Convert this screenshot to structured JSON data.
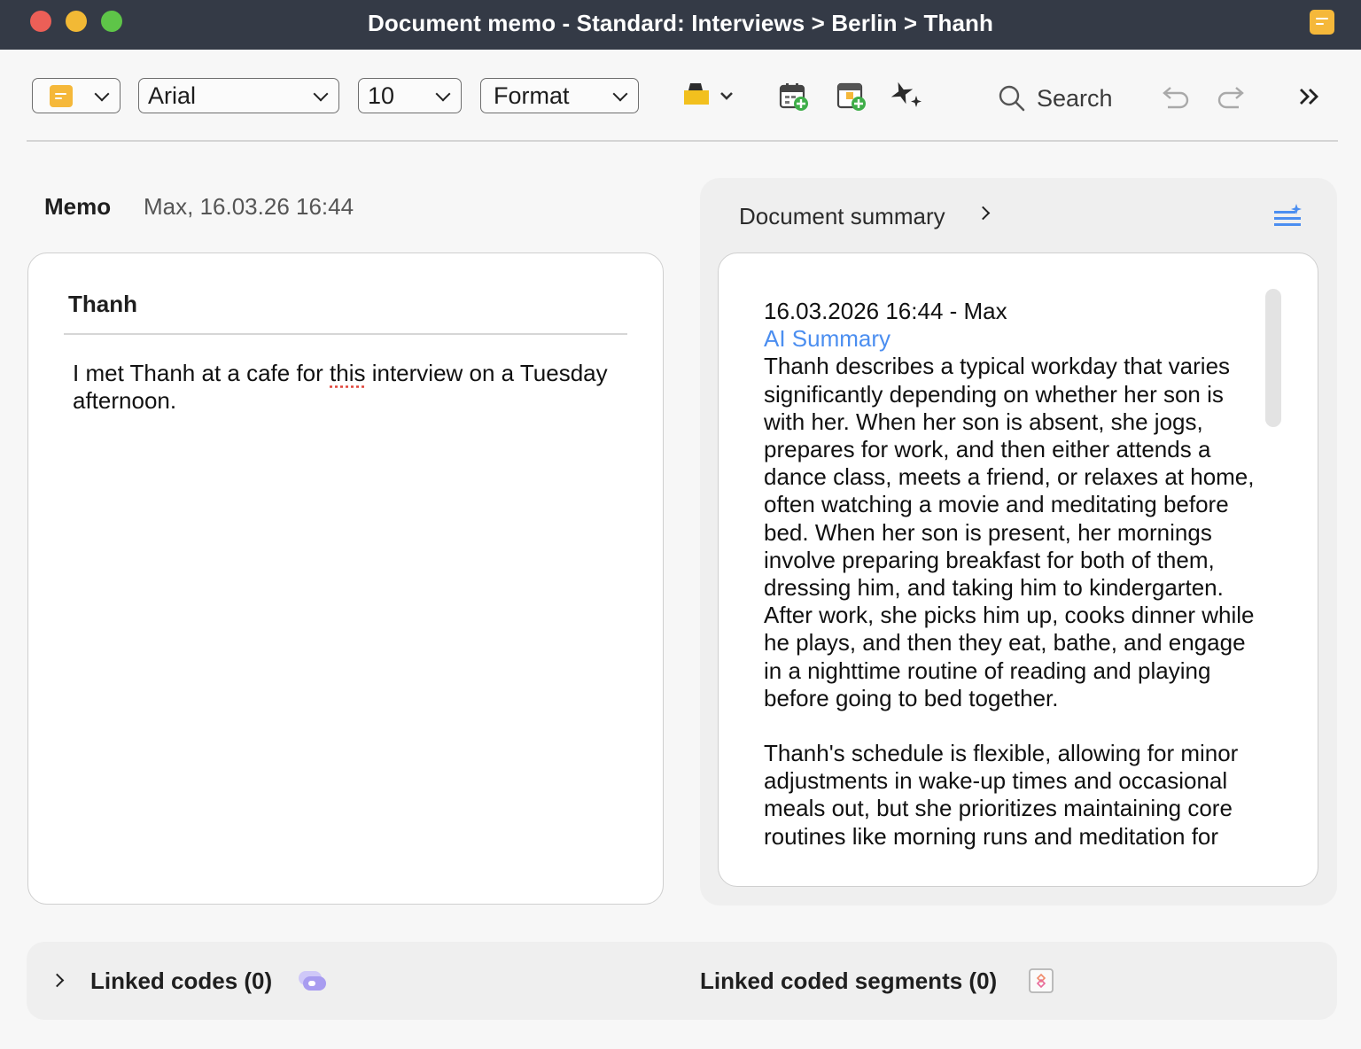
{
  "window": {
    "title": "Document memo - Standard: Interviews > Berlin > Thanh",
    "memo_icon": "memo-note-icon"
  },
  "toolbar": {
    "memo_type_icon": "memo-note-icon",
    "font_family": "Arial",
    "font_size": "10",
    "format": "Format",
    "highlight_icon": "highlighter-icon",
    "insert_date_icon": "calendar-add-icon",
    "insert_table_icon": "table-add-icon",
    "ai_icon": "ai-sparkle-icon",
    "search_label": "Search",
    "undo_icon": "undo-icon",
    "redo_icon": "redo-icon",
    "more_icon": "double-chevron-right-icon"
  },
  "memo": {
    "label": "Memo",
    "meta": "Max, 16.03.26 16:44",
    "title": "Thanh",
    "body_before": "I met Thanh at a cafe for ",
    "body_misspelled": "this",
    "body_after": " interview on a Tuesday afternoon."
  },
  "summary": {
    "title": "Document summary",
    "header": "16.03.2026 16:44 - Max",
    "ai_label": "AI Summary",
    "paragraph_1": "Thanh describes a typical workday that varies significantly depending on whether her son is with her. When her son is absent, she jogs, prepares for work, and then either attends a dance class, meets a friend, or relaxes at home, often watching a movie and meditating before bed. When her son is present, her mornings involve preparing breakfast for both of them, dressing him, and taking him to kindergarten. After work, she picks him up, cooks dinner while he plays, and then they eat, bathe, and engage in a nighttime routine of reading and playing before going to bed together.",
    "paragraph_2": "Thanh's schedule is flexible, allowing for minor adjustments in wake-up times and occasional meals out, but she prioritizes maintaining core routines like morning runs and meditation for"
  },
  "footer": {
    "linked_codes": "Linked codes (0)",
    "linked_segments": "Linked coded segments (0)"
  },
  "colors": {
    "titlebar": "#343a46",
    "memo_yellow": "#f5b83a",
    "ai_blue": "#4b8ef0",
    "codes_purple": "#a89cf0"
  }
}
